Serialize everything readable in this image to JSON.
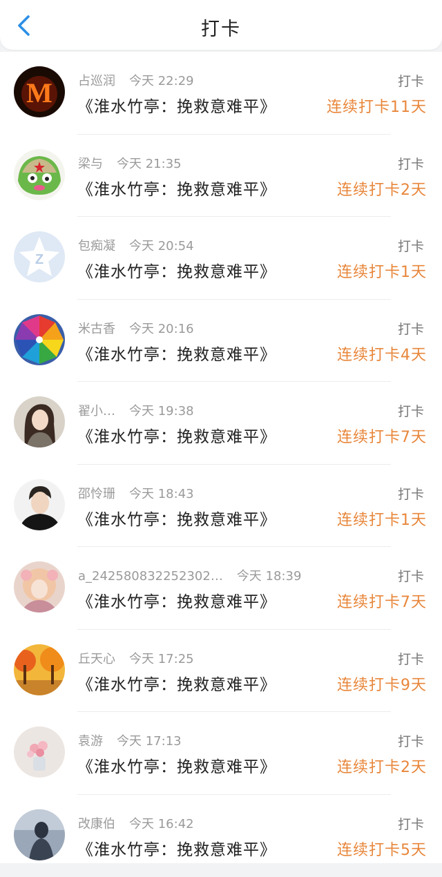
{
  "header": {
    "title": "打卡",
    "back_icon": "chevron-left-icon",
    "accent": "#2b8fe6"
  },
  "colors": {
    "streak": "#e8863a",
    "meta": "#9a9a9a"
  },
  "entries": [
    {
      "name": "占巡润",
      "time": "今天 22:29",
      "text": "《淮水竹亭：挽救意难平》",
      "tag": "打卡",
      "streak": "连续打卡11天",
      "avatar": "letter-m-fire"
    },
    {
      "name": "梁与",
      "time": "今天 21:35",
      "text": "《淮水竹亭：挽救意难平》",
      "tag": "打卡",
      "streak": "连续打卡2天",
      "avatar": "green-frog"
    },
    {
      "name": "包痴凝",
      "time": "今天 20:54",
      "text": "《淮水竹亭：挽救意难平》",
      "tag": "打卡",
      "streak": "连续打卡1天",
      "avatar": "qq-default"
    },
    {
      "name": "米古香",
      "time": "今天 20:16",
      "text": "《淮水竹亭：挽救意难平》",
      "tag": "打卡",
      "streak": "连续打卡4天",
      "avatar": "pinwheel"
    },
    {
      "name": "翟小…",
      "time": "今天 19:38",
      "text": "《淮水竹亭：挽救意难平》",
      "tag": "打卡",
      "streak": "连续打卡7天",
      "avatar": "girl-portrait"
    },
    {
      "name": "邵怜珊",
      "time": "今天 18:43",
      "text": "《淮水竹亭：挽救意难平》",
      "tag": "打卡",
      "streak": "连续打卡1天",
      "avatar": "boy-portrait"
    },
    {
      "name": "a_242580832252302…",
      "time": "今天 18:39",
      "text": "《淮水竹亭：挽救意难平》",
      "tag": "打卡",
      "streak": "连续打卡7天",
      "avatar": "anime-girl"
    },
    {
      "name": "丘天心",
      "time": "今天 17:25",
      "text": "《淮水竹亭：挽救意难平》",
      "tag": "打卡",
      "streak": "连续打卡9天",
      "avatar": "autumn-trees"
    },
    {
      "name": "袁游",
      "time": "今天 17:13",
      "text": "《淮水竹亭：挽救意难平》",
      "tag": "打卡",
      "streak": "连续打卡2天",
      "avatar": "flowers"
    },
    {
      "name": "改康伯",
      "time": "今天 16:42",
      "text": "《淮水竹亭：挽救意难平》",
      "tag": "打卡",
      "streak": "连续打卡5天",
      "avatar": "dark-figure"
    }
  ]
}
